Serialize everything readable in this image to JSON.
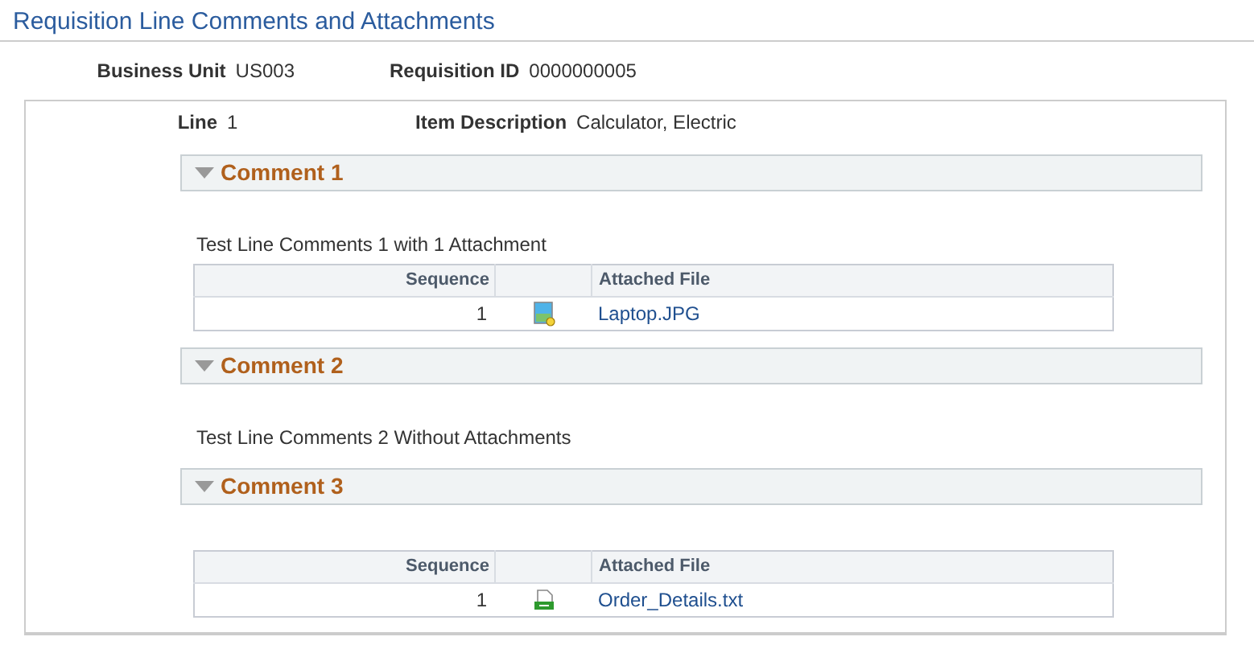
{
  "page_title": "Requisition Line Comments and Attachments",
  "header": [
    {
      "label": "Business Unit",
      "value": "US003"
    },
    {
      "label": "Requisition ID",
      "value": "0000000005"
    }
  ],
  "line": {
    "label": "Line",
    "value": "1",
    "item_label": "Item Description",
    "item_value": "Calculator, Electric"
  },
  "comments": [
    {
      "title": "Comment 1",
      "expanded": true,
      "text": "Test Line Comments 1 with 1 Attachment",
      "table": {
        "columns": [
          "Sequence",
          "Attached File"
        ],
        "rows": [
          {
            "sequence": "1",
            "kind": "image",
            "file": "Laptop.JPG"
          }
        ]
      }
    },
    {
      "title": "Comment 2",
      "expanded": true,
      "text": "Test Line Comments 2 Without Attachments"
    },
    {
      "title": "Comment 3",
      "expanded": true,
      "table": {
        "columns": [
          "Sequence",
          "Attached File"
        ],
        "rows": [
          {
            "sequence": "1",
            "kind": "text",
            "file": "Order_Details.txt"
          }
        ]
      }
    }
  ]
}
